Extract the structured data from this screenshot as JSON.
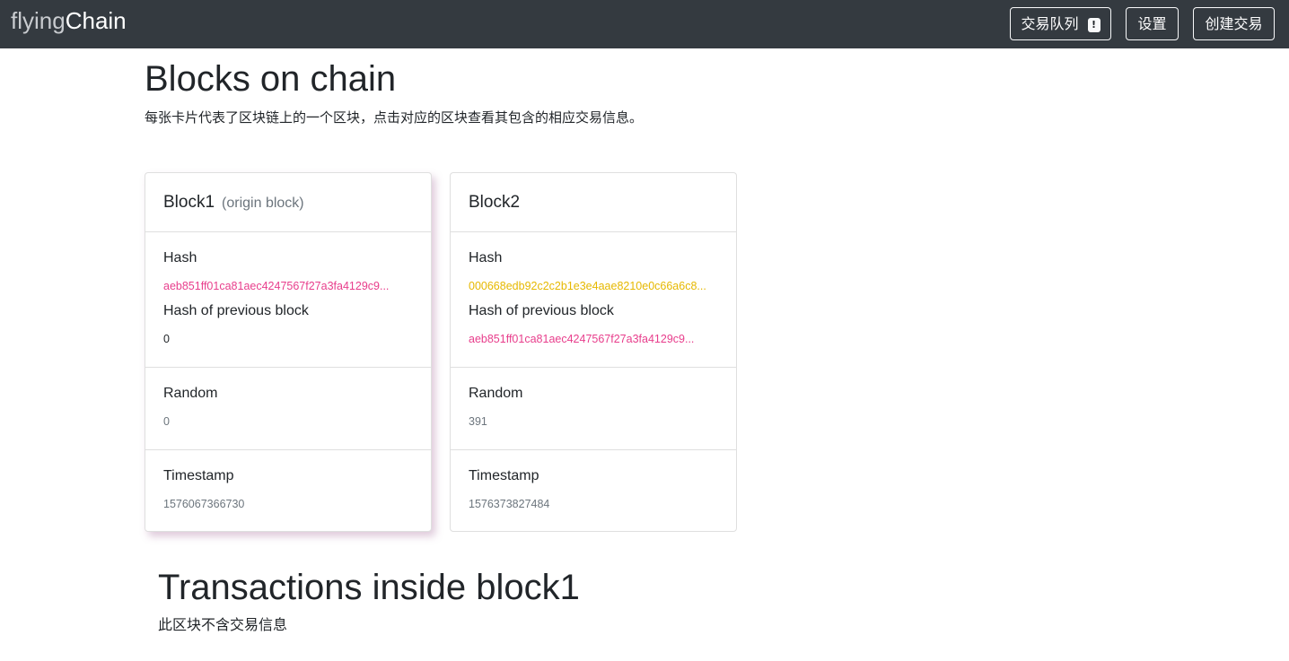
{
  "navbar": {
    "brand_part1": "flying",
    "brand_part2": "Chain",
    "queue_label": "交易队列",
    "queue_badge": "!",
    "settings_label": "设置",
    "create_label": "创建交易"
  },
  "page": {
    "title": "Blocks on chain",
    "lead": "每张卡片代表了区块链上的一个区块，点击对应的区块查看其包含的相应交易信息。"
  },
  "blocks": [
    {
      "title": "Block1",
      "subtitle": "(origin block)",
      "hash_label": "Hash",
      "hash": "aeb851ff01ca81aec4247567f27a3fa4129c9...",
      "prev_label": "Hash of previous block",
      "prev_hash": "0",
      "random_label": "Random",
      "random": "0",
      "timestamp_label": "Timestamp",
      "timestamp": "1576067366730"
    },
    {
      "title": "Block2",
      "hash_label": "Hash",
      "hash": "000668edb92c2c2b1e3e4aae8210e0c66a6c8...",
      "prev_label": "Hash of previous block",
      "prev_hash": "aeb851ff01ca81aec4247567f27a3fa4129c9...",
      "random_label": "Random",
      "random": "391",
      "timestamp_label": "Timestamp",
      "timestamp": "1576373827484"
    }
  ],
  "transactions": {
    "title": "Transactions inside block1",
    "empty_text": "此区块不含交易信息"
  },
  "colors": {
    "navbar_bg": "#343a40",
    "hash_pink": "#e83e8c",
    "hash_gold": "#e6b800"
  }
}
